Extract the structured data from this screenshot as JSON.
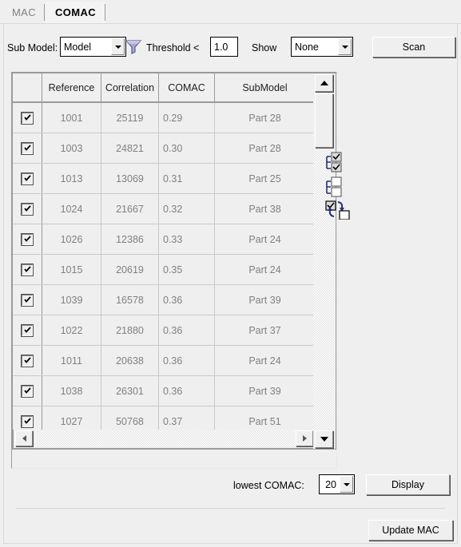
{
  "tabs": [
    {
      "label": "MAC",
      "active": false
    },
    {
      "label": "COMAC",
      "active": true
    }
  ],
  "toolbar": {
    "submodel_label": "Sub Model:",
    "submodel_value": "Model",
    "filter_icon": "funnel-icon",
    "threshold_label": "Threshold <",
    "threshold_value": "1.0",
    "show_label": "Show",
    "show_value": "None",
    "scan_label": "Scan"
  },
  "table": {
    "columns": [
      "",
      "Reference",
      "Correlation",
      "COMAC",
      "SubModel"
    ],
    "rows": [
      {
        "checked": true,
        "reference": "1001",
        "correlation": "25119",
        "comac": "0.29",
        "submodel": "Part 28"
      },
      {
        "checked": true,
        "reference": "1003",
        "correlation": "24821",
        "comac": "0.30",
        "submodel": "Part 28"
      },
      {
        "checked": true,
        "reference": "1013",
        "correlation": "13069",
        "comac": "0.31",
        "submodel": "Part 25"
      },
      {
        "checked": true,
        "reference": "1024",
        "correlation": "21667",
        "comac": "0.32",
        "submodel": "Part 38"
      },
      {
        "checked": true,
        "reference": "1026",
        "correlation": "12386",
        "comac": "0.33",
        "submodel": "Part 24"
      },
      {
        "checked": true,
        "reference": "1015",
        "correlation": "20619",
        "comac": "0.35",
        "submodel": "Part 24"
      },
      {
        "checked": true,
        "reference": "1039",
        "correlation": "16578",
        "comac": "0.36",
        "submodel": "Part 39"
      },
      {
        "checked": true,
        "reference": "1022",
        "correlation": "21880",
        "comac": "0.36",
        "submodel": "Part 37"
      },
      {
        "checked": true,
        "reference": "1011",
        "correlation": "20638",
        "comac": "0.36",
        "submodel": "Part 24"
      },
      {
        "checked": true,
        "reference": "1038",
        "correlation": "26301",
        "comac": "0.36",
        "submodel": "Part 39"
      },
      {
        "checked": true,
        "reference": "1027",
        "correlation": "50768",
        "comac": "0.37",
        "submodel": "Part 51"
      }
    ]
  },
  "selection_tools": [
    {
      "name": "check-all-icon"
    },
    {
      "name": "uncheck-all-icon"
    },
    {
      "name": "invert-selection-icon"
    }
  ],
  "footer": {
    "lowest_label": "lowest COMAC:",
    "lowest_value": "20",
    "display_label": "Display",
    "update_label": "Update MAC"
  },
  "colors": {
    "background": "#efefef",
    "cell_text": "#808080",
    "header_text": "#222222",
    "border": "#9a9a9a",
    "funnel": "#9a9cc8"
  }
}
